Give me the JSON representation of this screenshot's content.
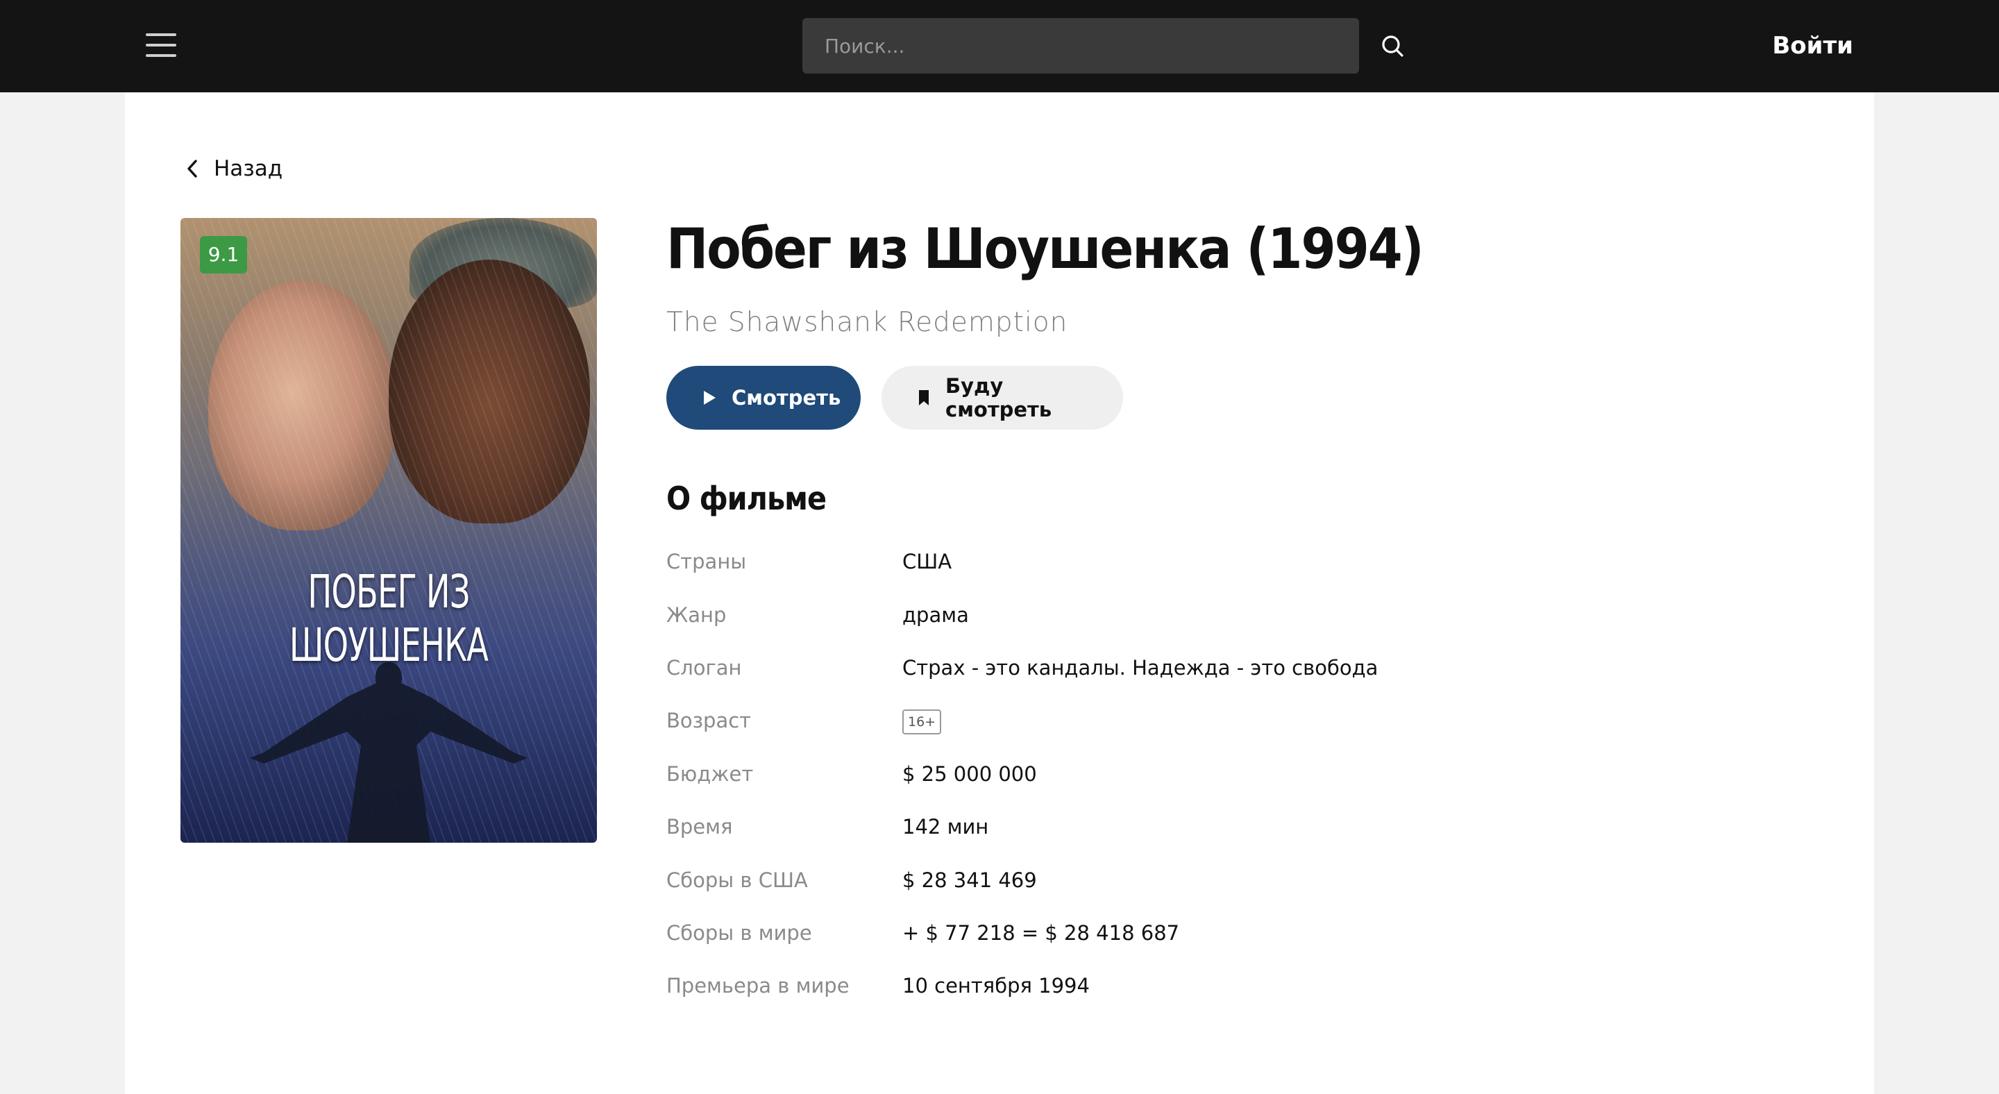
{
  "header": {
    "search_placeholder": "Поиск...",
    "login_label": "Войти"
  },
  "nav": {
    "back_label": "Назад"
  },
  "movie": {
    "title": "Побег из Шоушенка (1994)",
    "original_title": "The Shawshank Redemption",
    "rating": "9.1",
    "poster_title": "ПОБЕГ ИЗ ШОУШЕНКА",
    "rating_color": "#3c9a45"
  },
  "actions": {
    "watch_label": "Смотреть",
    "watch_later_label": "Буду смотреть",
    "accent_color": "#1f4a79"
  },
  "about": {
    "heading": "О фильме",
    "facts": [
      {
        "label": "Страны",
        "value": "США"
      },
      {
        "label": "Жанр",
        "value": "драма"
      },
      {
        "label": "Слоган",
        "value": "Страх - это кандалы. Надежда - это свобода"
      },
      {
        "label": "Возраст",
        "value": "16+"
      },
      {
        "label": "Бюджет",
        "value": "$ 25 000 000"
      },
      {
        "label": "Время",
        "value": "142 мин"
      },
      {
        "label": "Сборы в США",
        "value": "$ 28 341 469"
      },
      {
        "label": "Сборы в мире",
        "value": "+ $ 77 218 = $ 28 418 687"
      },
      {
        "label": "Премьера в мире",
        "value": "10 сентября 1994"
      }
    ]
  }
}
